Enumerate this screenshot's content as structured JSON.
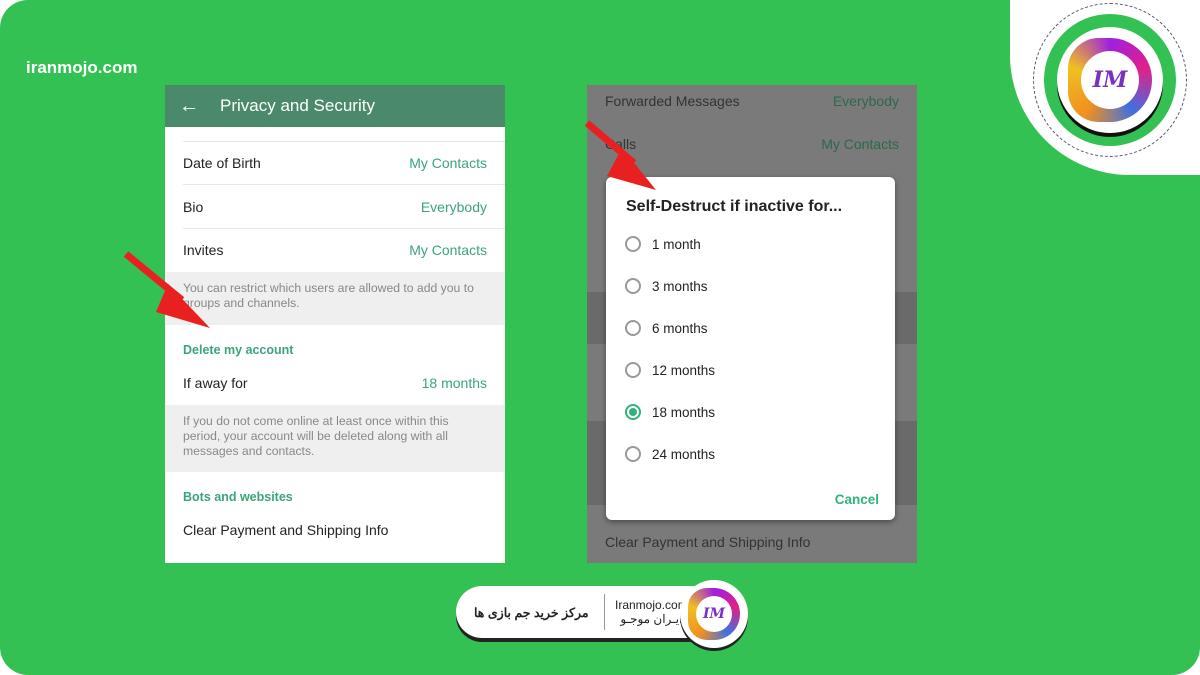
{
  "site_label": "iranmojo.com",
  "left_screen": {
    "title": "Privacy and Security",
    "rows": [
      {
        "label": "Date of Birth",
        "value": "My Contacts"
      },
      {
        "label": "Bio",
        "value": "Everybody"
      },
      {
        "label": "Invites",
        "value": "My Contacts"
      }
    ],
    "invites_note": "You can restrict which users are allowed to add you to groups and channels.",
    "delete_section": "Delete my account",
    "away": {
      "label": "If away for",
      "value": "18 months"
    },
    "away_note": "If you do not come online at least once within this period, your account will be deleted along with all messages and contacts.",
    "bots_section": "Bots and websites",
    "clear_payment": "Clear Payment and Shipping Info"
  },
  "right_screen": {
    "rows": [
      {
        "label": "Forwarded Messages",
        "value": "Everybody"
      },
      {
        "label": "Calls",
        "value": "My Contacts"
      }
    ],
    "clear_payment": "Clear Payment and Shipping Info",
    "dialog": {
      "title": "Self-Destruct if inactive for...",
      "options": [
        "1 month",
        "3 months",
        "6 months",
        "12 months",
        "18 months",
        "24 months"
      ],
      "selected": "18 months",
      "cancel": "Cancel"
    }
  },
  "footer": {
    "tagline": "مرکز خرید جم بازی ها",
    "domain": "Iranmojo.com",
    "brand": "ایـران موجـو",
    "logo_text": "IM"
  },
  "colors": {
    "background_green": "#33c153",
    "accent": "#3aa57a",
    "header": "#4a8a6a",
    "arrow": "#e82020"
  }
}
